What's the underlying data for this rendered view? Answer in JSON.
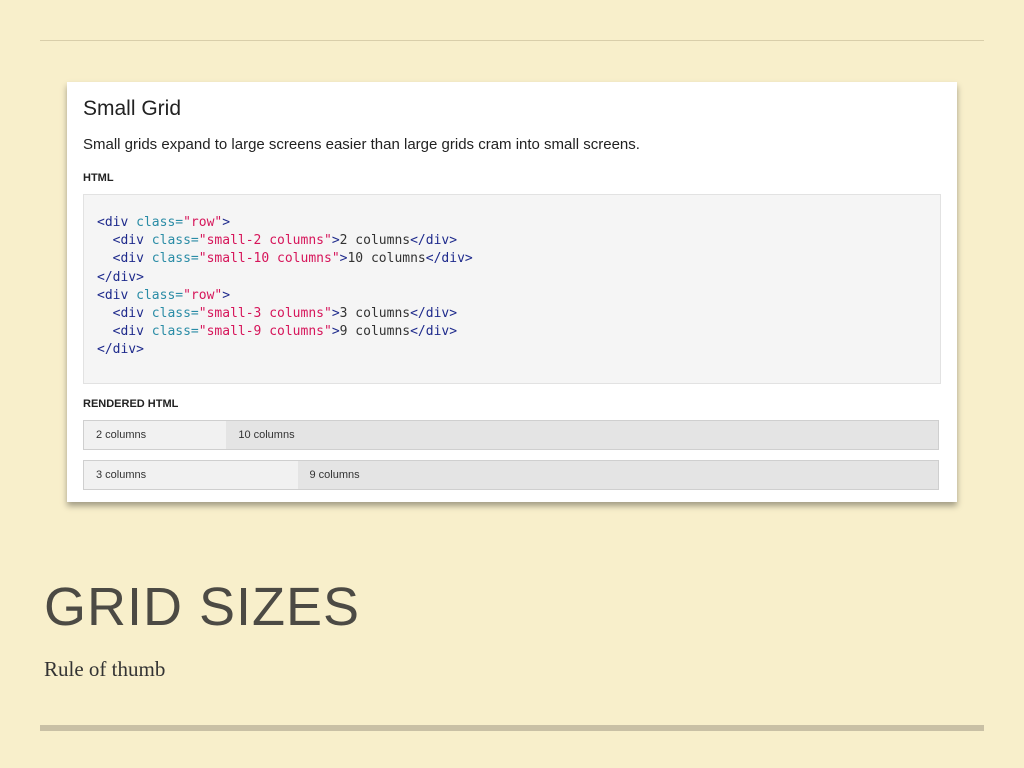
{
  "card": {
    "title": "Small Grid",
    "description": "Small grids expand to large screens easier than large grids cram into small screens.",
    "html_label": "HTML",
    "rendered_label": "RENDERED HTML"
  },
  "code": {
    "lines": [
      [
        {
          "t": "<div ",
          "c": "tag"
        },
        {
          "t": "class=",
          "c": "attr"
        },
        {
          "t": "\"row\"",
          "c": "str"
        },
        {
          "t": ">",
          "c": "tag"
        }
      ],
      [
        {
          "t": "  "
        },
        {
          "t": "<div ",
          "c": "tag"
        },
        {
          "t": "class=",
          "c": "attr"
        },
        {
          "t": "\"small-2 columns\"",
          "c": "str"
        },
        {
          "t": ">",
          "c": "tag"
        },
        {
          "t": "2 columns"
        },
        {
          "t": "</div>",
          "c": "tag"
        }
      ],
      [
        {
          "t": "  "
        },
        {
          "t": "<div ",
          "c": "tag"
        },
        {
          "t": "class=",
          "c": "attr"
        },
        {
          "t": "\"small-10 columns\"",
          "c": "str"
        },
        {
          "t": ">",
          "c": "tag"
        },
        {
          "t": "10 columns"
        },
        {
          "t": "</div>",
          "c": "tag"
        }
      ],
      [
        {
          "t": "</div>",
          "c": "tag"
        }
      ],
      [
        {
          "t": "<div ",
          "c": "tag"
        },
        {
          "t": "class=",
          "c": "attr"
        },
        {
          "t": "\"row\"",
          "c": "str"
        },
        {
          "t": ">",
          "c": "tag"
        }
      ],
      [
        {
          "t": "  "
        },
        {
          "t": "<div ",
          "c": "tag"
        },
        {
          "t": "class=",
          "c": "attr"
        },
        {
          "t": "\"small-3 columns\"",
          "c": "str"
        },
        {
          "t": ">",
          "c": "tag"
        },
        {
          "t": "3 columns"
        },
        {
          "t": "</div>",
          "c": "tag"
        }
      ],
      [
        {
          "t": "  "
        },
        {
          "t": "<div ",
          "c": "tag"
        },
        {
          "t": "class=",
          "c": "attr"
        },
        {
          "t": "\"small-9 columns\"",
          "c": "str"
        },
        {
          "t": ">",
          "c": "tag"
        },
        {
          "t": "9 columns"
        },
        {
          "t": "</div>",
          "c": "tag"
        }
      ],
      [
        {
          "t": "</div>",
          "c": "tag"
        }
      ]
    ]
  },
  "rendered": {
    "row1": {
      "cell1": "2 columns",
      "cell2": "10 columns"
    },
    "row2": {
      "cell1": "3 columns",
      "cell2": "9 columns"
    }
  },
  "slide": {
    "title": "GRID SIZES",
    "subtitle": "Rule of thumb"
  },
  "colors": {
    "background": "#f8efcb",
    "tag": "#1e2a8c",
    "attribute": "#2a8ca6",
    "string": "#d6155a"
  }
}
